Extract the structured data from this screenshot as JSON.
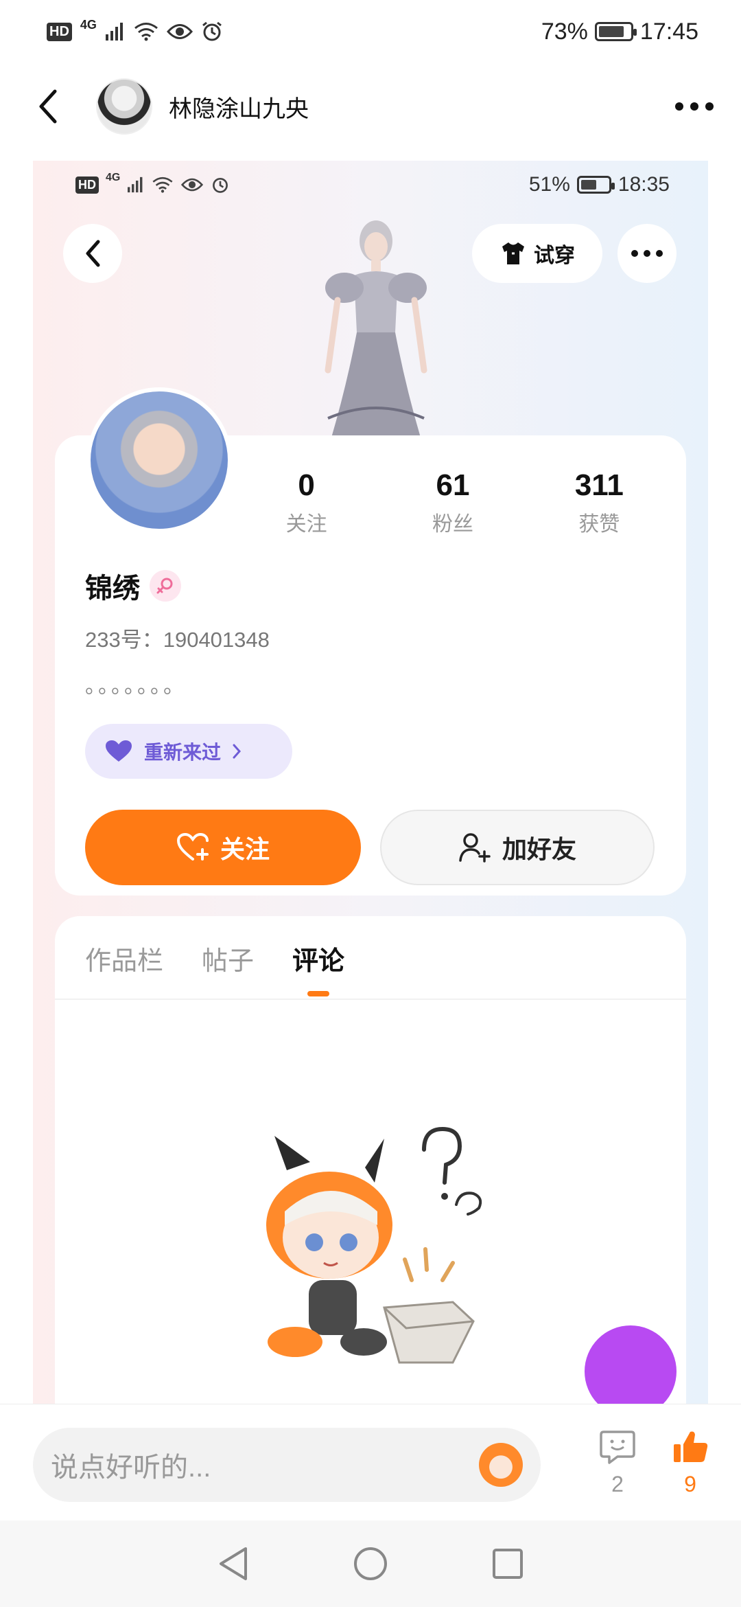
{
  "status_bar": {
    "hd": "HD",
    "network": "4G",
    "battery": "73%",
    "battery_level": 0.73,
    "time": "17:45"
  },
  "header": {
    "title": "林隐涂山九央"
  },
  "embedded_screenshot": {
    "status_bar": {
      "hd": "HD",
      "network": "4G",
      "battery": "51%",
      "battery_level": 0.51,
      "time": "18:35"
    },
    "try_on_label": "试穿",
    "stats": [
      {
        "value": "0",
        "label": "关注"
      },
      {
        "value": "61",
        "label": "粉丝"
      },
      {
        "value": "311",
        "label": "获赞"
      }
    ],
    "username": "锦绣",
    "gender_icon": "female-icon",
    "user_id": "233号：190401348",
    "bio": "。。。。。。。",
    "restart_label": "重新来过",
    "follow_label": "关注",
    "add_friend_label": "加好友",
    "tabs": [
      {
        "label": "作品栏",
        "active": false
      },
      {
        "label": "帖子",
        "active": false
      },
      {
        "label": "评论",
        "active": true
      }
    ]
  },
  "comment_bar": {
    "placeholder": "说点好听的...",
    "comment_count": "2",
    "like_count": "9"
  },
  "colors": {
    "accent": "#ff7a14",
    "restart_bg": "#ece9fc",
    "restart_text": "#6e5bd6",
    "fab": "#b84af2"
  }
}
